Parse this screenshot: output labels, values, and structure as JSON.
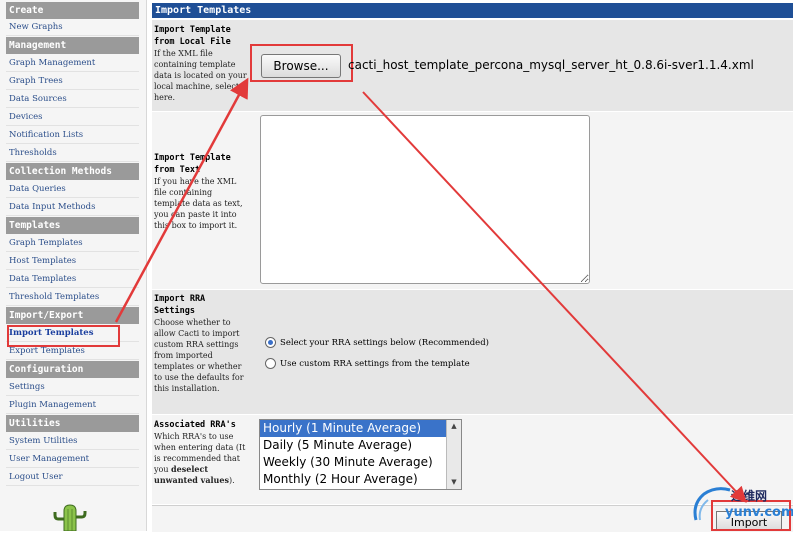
{
  "sidebar": {
    "sections": [
      {
        "header": "Create",
        "items": [
          "New Graphs"
        ]
      },
      {
        "header": "Management",
        "items": [
          "Graph Management",
          "Graph Trees",
          "Data Sources",
          "Devices",
          "Notification Lists",
          "Thresholds"
        ]
      },
      {
        "header": "Collection Methods",
        "items": [
          "Data Queries",
          "Data Input Methods"
        ]
      },
      {
        "header": "Templates",
        "items": [
          "Graph Templates",
          "Host Templates",
          "Data Templates",
          "Threshold Templates"
        ]
      },
      {
        "header": "Import/Export",
        "items": [
          "Import Templates",
          "Export Templates"
        ]
      },
      {
        "header": "Configuration",
        "items": [
          "Settings",
          "Plugin Management"
        ]
      },
      {
        "header": "Utilities",
        "items": [
          "System Utilities",
          "User Management",
          "Logout User"
        ]
      }
    ],
    "active_item": "Import Templates"
  },
  "main": {
    "title": "Import Templates",
    "local_file": {
      "title": "Import Template from Local File",
      "description": "If the XML file containing template data is located on your local machine, select it here.",
      "browse_label": "Browse...",
      "file_name": "cacti_host_template_percona_mysql_server_ht_0.8.6i-sver1.1.4.xml"
    },
    "text_import": {
      "title": "Import Template from Text",
      "description": "If you have the XML file containing template data as text, you can paste it into this box to import it.",
      "value": ""
    },
    "rra_settings": {
      "title": "Import RRA Settings",
      "description": "Choose whether to allow Cacti to import custom RRA settings from imported templates or whether to use the defaults for this installation.",
      "options": [
        {
          "label": "Select your RRA settings below (Recommended)",
          "checked": true
        },
        {
          "label": "Use custom RRA settings from the template",
          "checked": false
        }
      ]
    },
    "associated_rras": {
      "title": "Associated RRA's",
      "description_plain": "Which RRA's to use when entering data (It is recommended that you",
      "description_bold": "deselect unwanted values",
      "description_end": ").",
      "options": [
        {
          "label": "Hourly (1 Minute Average)",
          "selected": true
        },
        {
          "label": "Daily (5 Minute Average)",
          "selected": false
        },
        {
          "label": "Weekly (30 Minute Average)",
          "selected": false
        },
        {
          "label": "Monthly (2 Hour Average)",
          "selected": false
        }
      ]
    },
    "import_label": "Import"
  },
  "watermark": {
    "top": "运维网",
    "bottom": "yunv.com"
  },
  "colors": {
    "highlight": "#e23a3a",
    "title_bar": "#1f4f96",
    "menu_header": "#9a9a9a",
    "link": "#2b4e8a"
  }
}
